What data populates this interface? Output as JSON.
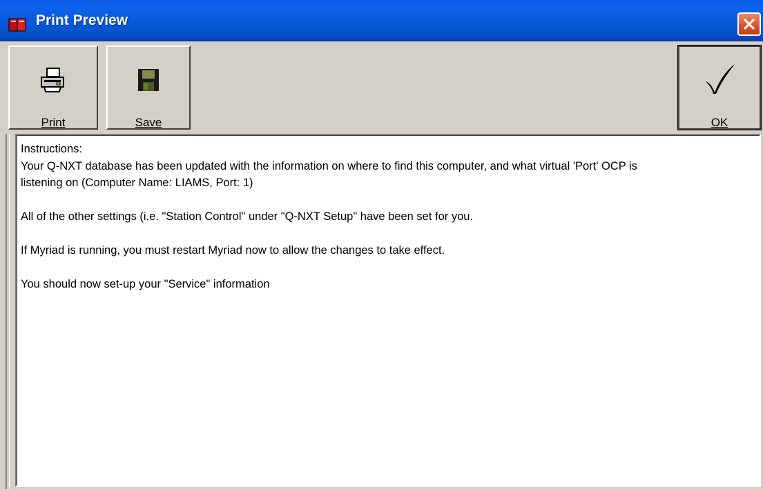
{
  "window": {
    "title": "Print Preview"
  },
  "toolbar": {
    "print_label": "Print",
    "save_label": "Save",
    "ok_label": "OK"
  },
  "icons": {
    "title": "book-icon",
    "print": "printer-icon",
    "save": "floppy-disk-icon",
    "ok": "checkmark-icon",
    "close": "close-icon"
  },
  "content": {
    "lines": [
      "Instructions:",
      "Your Q-NXT database has been updated with the information on where to find this computer, and what virtual 'Port' OCP is",
      "listening on (Computer Name: LIAMS, Port: 1)",
      "",
      "All of the other settings (i.e. \"Station Control\" under \"Q-NXT Setup\" have been set for you.",
      "",
      "If Myriad is running, you must restart Myriad now to allow the changes to take effect.",
      "",
      "You should now set-up your \"Service\" information"
    ]
  },
  "colors": {
    "titlebar": "#0758d8",
    "close_button": "#d8552e",
    "face": "#d4d0c8"
  }
}
